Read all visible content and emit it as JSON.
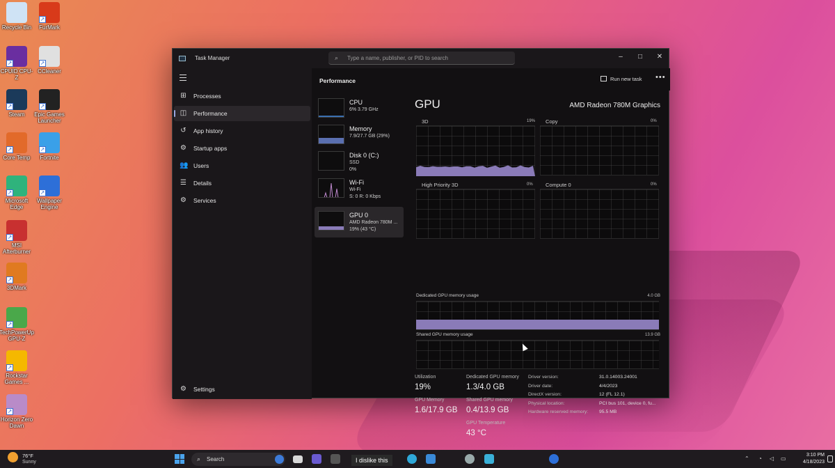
{
  "desktop": {
    "icons": [
      {
        "label": "Recycle Bin",
        "icon": "recycle-bin-icon",
        "color": "#cfe3f5"
      },
      {
        "label": "FurMark",
        "icon": "furmark-icon",
        "color": "#d83a1a"
      },
      {
        "label": "CPUID CPU-Z",
        "icon": "cpuz-icon",
        "color": "#6a2ea0"
      },
      {
        "label": "CCleaner",
        "icon": "ccleaner-icon",
        "color": "#e0e0e0"
      },
      {
        "label": "Steam",
        "icon": "steam-icon",
        "color": "#1b3a5a"
      },
      {
        "label": "Epic Games Launcher",
        "icon": "epic-games-icon",
        "color": "#222222"
      },
      {
        "label": "Core Temp",
        "icon": "core-temp-icon",
        "color": "#e26a2a"
      },
      {
        "label": "Fortnite",
        "icon": "fortnite-icon",
        "color": "#3aa0e8"
      },
      {
        "label": "Microsoft Edge",
        "icon": "edge-icon",
        "color": "#2fb37c"
      },
      {
        "label": "Wallpaper Engine",
        "icon": "wallpaper-engine-icon",
        "color": "#2d6fd8"
      },
      {
        "label": "MSI Afterburner",
        "icon": "msi-afterburner-icon",
        "color": "#c83030"
      },
      {
        "label": "3DMark",
        "icon": "3dmark-icon",
        "color": "#e07a20"
      },
      {
        "label": "TechPowerUp GPU-Z",
        "icon": "gpuz-icon",
        "color": "#4aa84a"
      },
      {
        "label": "Rockstar Games ...",
        "icon": "rockstar-icon",
        "color": "#f5b800"
      },
      {
        "label": "Horizon Zero Dawn",
        "icon": "horizon-icon",
        "color": "#b98bc8"
      }
    ]
  },
  "window": {
    "title": "Task Manager",
    "search_placeholder": "Type a name, publisher, or PID to search",
    "minimize": "–",
    "maximize": "□",
    "close": "✕"
  },
  "sidebar": {
    "items": [
      {
        "label": "Processes",
        "icon": "processes-icon",
        "glyph": "⊞"
      },
      {
        "label": "Performance",
        "icon": "performance-icon",
        "glyph": "◫",
        "active": true
      },
      {
        "label": "App history",
        "icon": "app-history-icon",
        "glyph": "↺"
      },
      {
        "label": "Startup apps",
        "icon": "startup-apps-icon",
        "glyph": "⚙"
      },
      {
        "label": "Users",
        "icon": "users-icon",
        "glyph": "👥"
      },
      {
        "label": "Details",
        "icon": "details-icon",
        "glyph": "☰"
      },
      {
        "label": "Services",
        "icon": "services-icon",
        "glyph": "⚙"
      }
    ],
    "settings_label": "Settings"
  },
  "header": {
    "title": "Performance",
    "run_task_label": "Run new task",
    "more_label": "•••"
  },
  "devices": [
    {
      "name": "CPU",
      "lines": [
        "6% 3.79 GHz"
      ]
    },
    {
      "name": "Memory",
      "lines": [
        "7.9/27.7 GB (29%)"
      ]
    },
    {
      "name": "Disk 0 (C:)",
      "lines": [
        "SSD",
        "0%"
      ]
    },
    {
      "name": "Wi-Fi",
      "lines": [
        "Wi-Fi",
        "S: 0 R: 0 Kbps"
      ]
    },
    {
      "name": "GPU 0",
      "lines": [
        "AMD Radeon 780M ...",
        "19% (43 °C)"
      ],
      "active": true
    }
  ],
  "gpu": {
    "title": "GPU",
    "model": "AMD Radeon 780M Graphics",
    "engines": [
      {
        "label": "3D",
        "pct": "19%",
        "level": 0.19
      },
      {
        "label": "Copy",
        "pct": "0%",
        "level": 0
      },
      {
        "label": "High Priority 3D",
        "pct": "0%",
        "level": 0
      },
      {
        "label": "Compute 0",
        "pct": "0%",
        "level": 0
      }
    ],
    "dedicated_label": "Dedicated GPU memory usage",
    "dedicated_max": "4.0 GB",
    "dedicated_fraction": 0.33,
    "shared_label": "Shared GPU memory usage",
    "shared_max": "13.9 GB",
    "stats": {
      "utilization_label": "Utilization",
      "utilization_value": "19%",
      "dedicated_mem_label": "Dedicated GPU memory",
      "dedicated_mem_value": "1.3/4.0 GB",
      "gpu_memory_label": "GPU Memory",
      "gpu_memory_value": "1.6/17.9 GB",
      "shared_mem_label": "Shared GPU memory",
      "shared_mem_value": "0.4/13.9 GB",
      "temp_label": "GPU Temperature",
      "temp_value": "43 °C"
    },
    "info": [
      {
        "key": "Driver version:",
        "value": "31.0.14003.24001"
      },
      {
        "key": "Driver date:",
        "value": "4/4/2023"
      },
      {
        "key": "DirectX version:",
        "value": "12 (FL 12.1)"
      },
      {
        "key": "Physical location:",
        "value": "PCI bus 101, device 0, fu..."
      },
      {
        "key": "Hardware reserved memory:",
        "value": "95.5 MB"
      }
    ],
    "accent": "#8a7bb8"
  },
  "taskbar": {
    "weather_temp": "76°F",
    "weather_cond": "Sunny",
    "search_label": "Search",
    "caption": "I dislike this",
    "time": "3:10 PM",
    "date": "4/18/2023"
  }
}
